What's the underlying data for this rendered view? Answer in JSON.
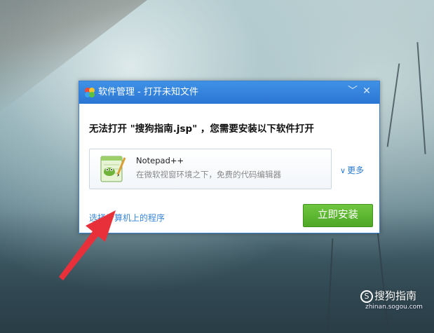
{
  "dialog": {
    "title": "软件管理 - 打开未知文件",
    "min_glyph": "﹀",
    "close_glyph": "✕",
    "heading": "无法打开 \"搜狗指南.jsp\" ，您需要安装以下软件打开",
    "software": {
      "name": "Notepad++",
      "description": "在微软视窗环境之下，免费的代码编辑器",
      "icon": "notepad-plus-plus-icon"
    },
    "more_label": "更多",
    "choose_program_label": "选择计算机上的程序",
    "install_label": "立即安装"
  },
  "watermark": {
    "brand": "搜狗指南",
    "icon_glyph": "S",
    "sub": "zhinan.sogou.com"
  },
  "colors": {
    "titlebar": "#2a76d3",
    "install": "#4ea826",
    "link": "#3a86d8",
    "arrow": "#e8303a"
  }
}
